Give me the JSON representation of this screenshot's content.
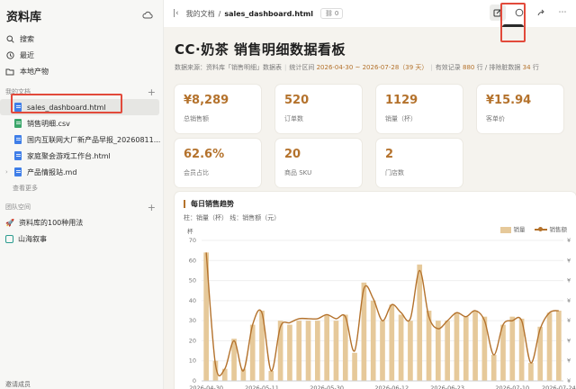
{
  "sidebar": {
    "title": "资料库",
    "nav": [
      {
        "label": "搜索",
        "icon": "search-icon"
      },
      {
        "label": "最近",
        "icon": "clock-icon"
      },
      {
        "label": "本地产物",
        "icon": "folder-icon"
      }
    ],
    "my_docs_label": "我的文档",
    "files": [
      {
        "label": "sales_dashboard.html",
        "color": "blue"
      },
      {
        "label": "销售明细.csv",
        "color": "green"
      },
      {
        "label": "国内互联网大厂新产品早报_20260811...",
        "color": "blue"
      },
      {
        "label": "家庭聚会游戏工作台.html",
        "color": "blue"
      },
      {
        "label": "产品情报站.md",
        "color": "blue"
      }
    ],
    "see_more": "查看更多",
    "team_label": "团队空间",
    "team_items": [
      {
        "label": "资料库的100种用法",
        "emoji": "🚀"
      },
      {
        "label": "山海叙事",
        "emoji": ""
      }
    ],
    "footer": "邀请成员"
  },
  "topbar": {
    "crumb_parent": "我的文档",
    "crumb_sep": "/",
    "crumb_current": "sales_dashboard.html",
    "link_count": "0",
    "tooltip": "编辑"
  },
  "page": {
    "title": "CC·奶茶 销售明细数据看板",
    "meta": {
      "source_prefix": "数据来源：资料库「销售明细」数据表",
      "range_prefix": "统计区间",
      "range": "2026-04-30 ~ 2026-07-28（39 天）",
      "valid_prefix": "有效记录",
      "valid": "880",
      "valid_suffix": "行 / 排除脏数据",
      "dirty": "34",
      "dirty_suffix": "行"
    },
    "kpis": [
      {
        "value": "¥8,289",
        "label": "总销售额"
      },
      {
        "value": "520",
        "label": "订单数"
      },
      {
        "value": "1129",
        "label": "销量（杯）"
      },
      {
        "value": "¥15.94",
        "label": "客单价"
      },
      {
        "value": "62.6%",
        "label": "会员占比"
      },
      {
        "value": "20",
        "label": "商品 SKU"
      },
      {
        "value": "2",
        "label": "门店数"
      }
    ]
  },
  "chart_data": {
    "type": "bar",
    "title": "每日销售趋势",
    "subtitle": "柱：销量（杯）  线：销售额（元）",
    "y_unit": "杯",
    "ylim": [
      0,
      70
    ],
    "yticks": [
      0,
      10,
      20,
      30,
      40,
      50,
      60,
      70
    ],
    "xtick_labels": [
      "2026-04-30",
      "2026-05-11",
      "2026-05-30",
      "2026-06-12",
      "2026-06-23",
      "2026-07-10",
      "2026-07-24"
    ],
    "xtick_index": [
      0,
      6,
      13,
      20,
      26,
      33,
      38
    ],
    "right_axis_symbol": "¥",
    "series": [
      {
        "name": "销量",
        "values": [
          64,
          10,
          6,
          21,
          6,
          28,
          35,
          5,
          30,
          28,
          30,
          30,
          30,
          33,
          30,
          33,
          14,
          49,
          40,
          30,
          38,
          33,
          30,
          58,
          35,
          30,
          30,
          34,
          32,
          35,
          32,
          13,
          28,
          32,
          31,
          9,
          27,
          34,
          35
        ]
      },
      {
        "name": "销售额",
        "values": [
          64,
          8,
          6,
          20,
          5,
          28,
          34,
          5,
          27,
          29,
          31,
          31,
          31,
          33,
          31,
          32,
          15,
          46,
          41,
          30,
          38,
          34,
          31,
          55,
          32,
          26,
          30,
          34,
          32,
          35,
          30,
          13,
          28,
          30,
          30,
          9,
          26,
          34,
          35
        ]
      }
    ],
    "colors": {
      "bar": "#e6c99a",
      "line": "#b4722c"
    },
    "legend_position": "top-right"
  }
}
